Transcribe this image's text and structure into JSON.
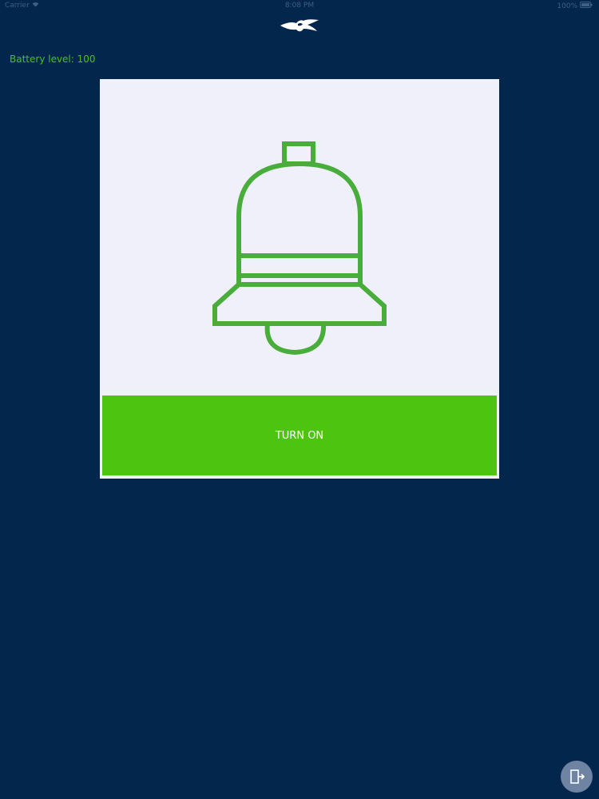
{
  "status_bar": {
    "carrier": "Carrier",
    "time": "8:08 PM",
    "battery": "100%"
  },
  "app": {
    "logo_icon": "bird-logo-icon"
  },
  "battery_level_text": "Battery level: 100",
  "alarm_card": {
    "icon": "bell-icon",
    "button_label": "TURN ON"
  },
  "exit": {
    "icon": "exit-door-icon"
  },
  "colors": {
    "background": "#03264d",
    "accent_green": "#4cc410",
    "card_background": "#f0f0fa",
    "bell_stroke": "#49ad3c"
  }
}
